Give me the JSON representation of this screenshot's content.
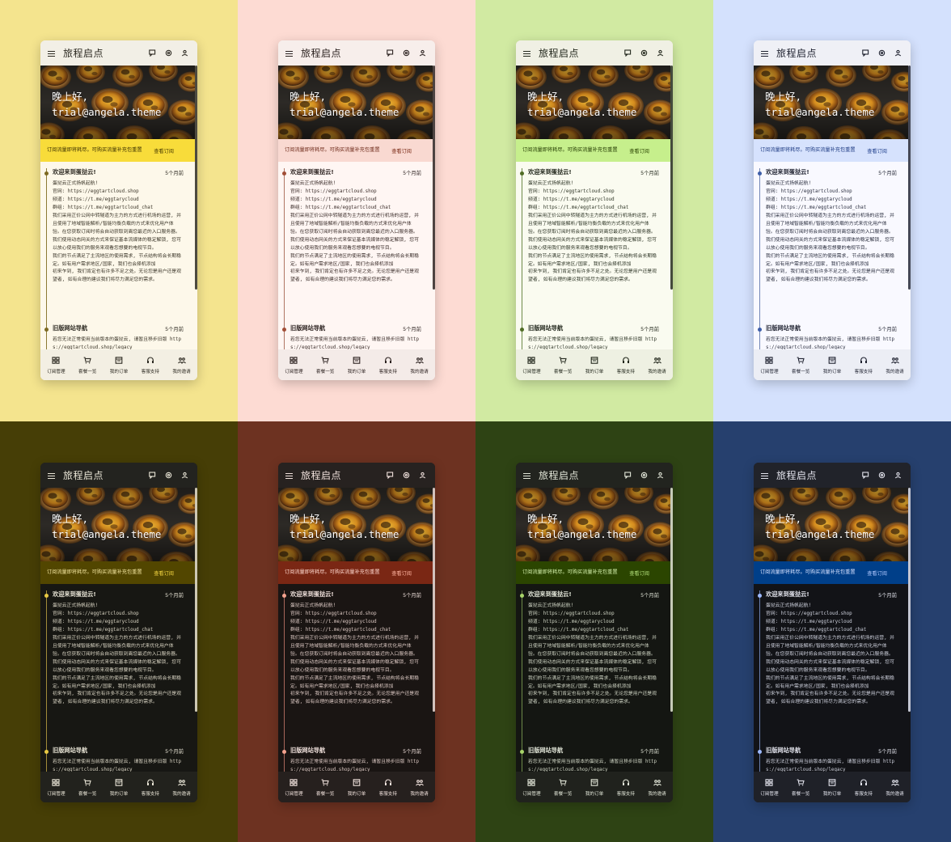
{
  "app": {
    "title": "旅程启点",
    "greeting_line1": "晚上好,",
    "greeting_line2": "trial@angela.theme",
    "subscription_notice": "订阅流量即将耗尽。可购买流量补充包重置",
    "subscription_link": "查看订阅",
    "top_icons": [
      "chat-icon",
      "settings-icon",
      "user-icon"
    ],
    "timeline": [
      {
        "title": "欢迎来到蛋挞云!",
        "time": "5个月前",
        "body": "蛋挞云正式扬帆起航!\n官网: https://eggtartcloud.shop\n频道: https://t.me/eggtarycloud\n群组: https://t.me/eggtartcloud_chat\n我们采用正价公网中转隧道为主力的方式进行机场的运营, 并且使用了地域智能解析/智能均衡负载的方式来优化用户体验。在您获取订阅时将会自动获取到离您最近的入口服务器。\n我们使用动态网关的方式来保证基本流媒体的稳定解锁, 您可以放心使用我们的服务来观看您想要的电视节目。\n我们的节点满足了主流地区的使用需求, 节点结构将会长期稳定。如有用户需求地区/国家, 我们也会择机添加\n初来乍到, 我们肯定也有许多不足之处。无论您是用户还是观望者, 如有合理的建议我们将尽力满足您的需求。"
      },
      {
        "title": "旧版网站导航",
        "time": "5个月前",
        "body": "若您无法正常使用当前版本的蛋挞云, 请暂且移步旧版 https://eggtartcloud.shop/legacy"
      }
    ],
    "nav": [
      {
        "label": "订阅管理",
        "icon": "dashboard-icon"
      },
      {
        "label": "套餐一览",
        "icon": "cart-icon"
      },
      {
        "label": "我的订单",
        "icon": "orders-icon"
      },
      {
        "label": "客服支持",
        "icon": "support-icon"
      },
      {
        "label": "我的邀请",
        "icon": "invite-icon"
      }
    ]
  },
  "themes": [
    {
      "name": "yellow-light",
      "bg": "#f4e48e",
      "bar": "#f2efe6",
      "page": "#fdf8ea",
      "text": "#2d2a22",
      "muted": "#3a3528",
      "accent": "#f8dc3a",
      "accent_text": "#4a3d00",
      "line": "#8c7a34",
      "dot": "#7d6a22",
      "nav_bg": "#f3efe3",
      "scroll": "#4d4a3f",
      "notice_text": "#3b3000"
    },
    {
      "name": "red-light",
      "bg": "#fddbd3",
      "bar": "#f7eeeb",
      "page": "#fff6f3",
      "text": "#2c2220",
      "muted": "#3a2d2a",
      "accent": "#f9d9d1",
      "accent_text": "#7a2a16",
      "line": "#b07564",
      "dot": "#a14d36",
      "nav_bg": "#f4ebe8",
      "scroll": "#4c4341",
      "notice_text": "#6e2a1a"
    },
    {
      "name": "green-light",
      "bg": "#d1eaa2",
      "bar": "#f0f0e4",
      "page": "#fafbf0",
      "text": "#22271c",
      "muted": "#2d3425",
      "accent": "#c6ef8c",
      "accent_text": "#2a4400",
      "line": "#6e8a4a",
      "dot": "#4f6b25",
      "nav_bg": "#eef0e2",
      "scroll": "#444a3c",
      "notice_text": "#223a00"
    },
    {
      "name": "blue-light",
      "bg": "#d4e1fd",
      "bar": "#eff0f6",
      "page": "#f9f9ff",
      "text": "#1f2230",
      "muted": "#2a2e3e",
      "accent": "#d6e2fd",
      "accent_text": "#1e3e8a",
      "line": "#7286b6",
      "dot": "#3e5ea8",
      "nav_bg": "#eceef5",
      "scroll": "#454856",
      "notice_text": "#1c3a82"
    },
    {
      "name": "yellow-dark",
      "bg": "#463e06",
      "bar": "#23231f",
      "page": "#171713",
      "text": "#e9e5d6",
      "muted": "#d8d3c2",
      "accent": "#524600",
      "accent_text": "#f5d842",
      "line": "#a18c3a",
      "dot": "#e7c943",
      "nav_bg": "#22221d",
      "scroll": "#cdc7b3",
      "notice_text": "#f4e6a0"
    },
    {
      "name": "red-dark",
      "bg": "#6d3221",
      "bar": "#272220",
      "page": "#1a1513",
      "text": "#f0e1dc",
      "muted": "#ddcac4",
      "accent": "#7a2714",
      "accent_text": "#ffb4a0",
      "line": "#a8675a",
      "dot": "#f4a28e",
      "nav_bg": "#26201e",
      "scroll": "#d2c2bd",
      "notice_text": "#ffd9cf"
    },
    {
      "name": "green-dark",
      "bg": "#2e4314",
      "bar": "#22241f",
      "page": "#141612",
      "text": "#e2e6d8",
      "muted": "#cfd4c3",
      "accent": "#2b4500",
      "accent_text": "#b3e07a",
      "line": "#6e8a4a",
      "dot": "#a8d46a",
      "nav_bg": "#20221d",
      "scroll": "#c6cbb8",
      "notice_text": "#d6f2ad"
    },
    {
      "name": "blue-dark",
      "bg": "#26406e",
      "bar": "#21232a",
      "page": "#121317",
      "text": "#e2e3ec",
      "muted": "#cdd0dc",
      "accent": "#003f89",
      "accent_text": "#b1c8ff",
      "line": "#6a7fae",
      "dot": "#9db9fd",
      "nav_bg": "#1f2128",
      "scroll": "#c3c6d3",
      "notice_text": "#d8e2ff"
    }
  ]
}
